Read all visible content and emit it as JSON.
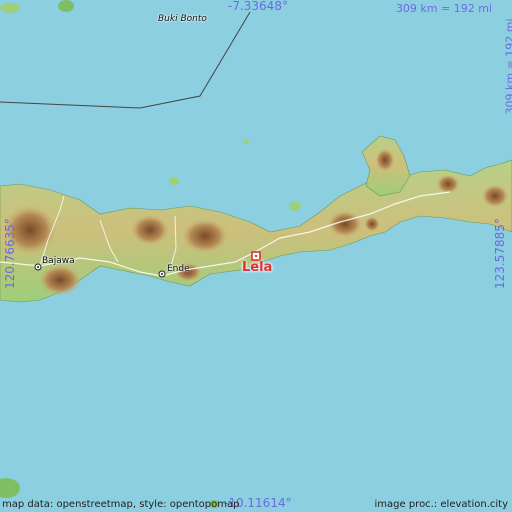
{
  "coords": {
    "top_lat": "-7.33648°",
    "bottom_lat": "-10.11614°",
    "left_lon": "120.76635°",
    "right_lon": "123.57885°"
  },
  "scale": {
    "top": "309 km = 192 mi",
    "right": "309 km = 192 mi"
  },
  "places": {
    "main": "Lela",
    "bajawa": "Bajawa",
    "ende": "Ende",
    "buki_bonto": "Buki Bonto"
  },
  "credits": {
    "map_data": "map data: openstreetmap, style: opentopomap",
    "image_proc": "image proc.: elevation.city"
  },
  "colors": {
    "sea": "#8ccfe0",
    "land_low": "#9ccf7a",
    "land_mid": "#cdbf7c",
    "land_high": "#a5784a",
    "coord_text": "#6b6be0",
    "marker": "#e03030"
  }
}
